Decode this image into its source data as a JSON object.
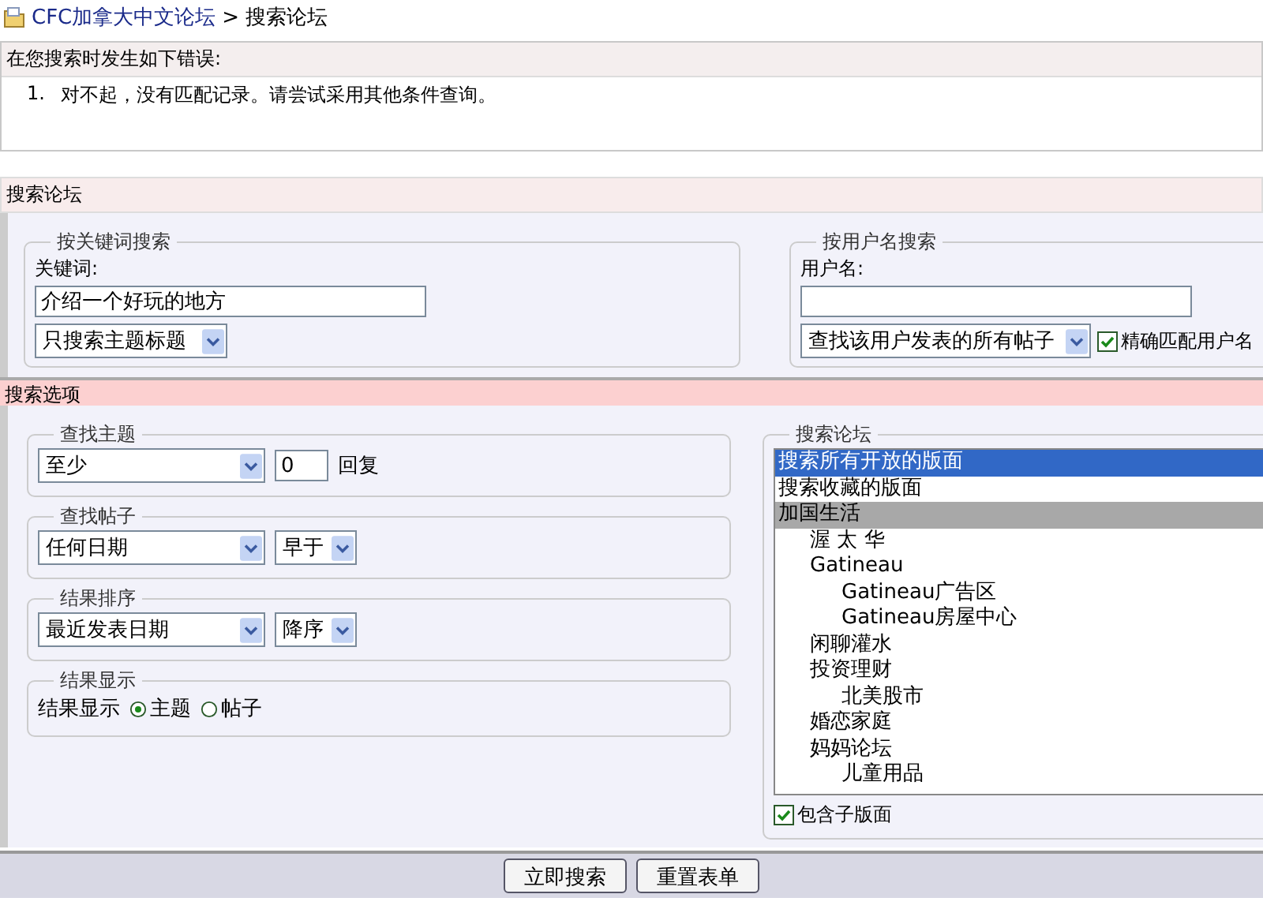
{
  "breadcrumb": {
    "site": "CFC加拿大中文论坛",
    "separator": ">",
    "current": "搜索论坛"
  },
  "error": {
    "title": "在您搜索时发生如下错误:",
    "messages": [
      {
        "number": "1.",
        "text": "对不起，没有匹配记录。请尝试采用其他条件查询。"
      }
    ]
  },
  "search_forum": {
    "title": "搜索论坛",
    "keyword": {
      "legend": "按关键词搜索",
      "label": "关键词:",
      "value": "介绍一个好玩的地方",
      "scope": "只搜索主题标题"
    },
    "user": {
      "legend": "按用户名搜索",
      "label": "用户名:",
      "scope": "查找该用户发表的所有帖子",
      "exact_match": {
        "label": "精确匹配用户名",
        "checked": true
      }
    }
  },
  "search_options": {
    "title": "搜索选项",
    "find_threads": {
      "legend": "查找主题",
      "condition": "至少",
      "count": "0",
      "unit": "回复"
    },
    "find_posts": {
      "legend": "查找帖子",
      "date": "任何日期",
      "direction": "早于"
    },
    "sort": {
      "legend": "结果排序",
      "field": "最近发表日期",
      "order": "降序"
    },
    "display": {
      "legend": "结果显示",
      "label": "结果显示",
      "options": [
        {
          "label": "主题",
          "selected": true
        },
        {
          "label": "帖子",
          "selected": false
        }
      ]
    },
    "forums": {
      "legend": "搜索论坛",
      "items": [
        {
          "label": "搜索所有开放的版面",
          "kind": "option",
          "selected": true
        },
        {
          "label": "搜索收藏的版面",
          "kind": "option",
          "selected": false
        },
        {
          "label": "加国生活",
          "kind": "category",
          "selected": false,
          "children": [
            {
              "label": "渥 太 华",
              "kind": "forum",
              "selected": false
            },
            {
              "label": "Gatineau",
              "kind": "forum",
              "selected": false,
              "children": [
                {
                  "label": "Gatineau广告区",
                  "kind": "forum",
                  "selected": false
                },
                {
                  "label": "Gatineau房屋中心",
                  "kind": "forum",
                  "selected": false
                }
              ]
            },
            {
              "label": "闲聊灌水",
              "kind": "forum",
              "selected": false
            },
            {
              "label": "投资理财",
              "kind": "forum",
              "selected": false,
              "children": [
                {
                  "label": "北美股市",
                  "kind": "forum",
                  "selected": false
                }
              ]
            },
            {
              "label": "婚恋家庭",
              "kind": "forum",
              "selected": false
            },
            {
              "label": "妈妈论坛",
              "kind": "forum",
              "selected": false,
              "children": [
                {
                  "label": "儿童用品",
                  "kind": "forum",
                  "selected": false
                }
              ]
            }
          ]
        }
      ],
      "include_subforums": {
        "label": "包含子版面",
        "checked": true
      }
    }
  },
  "buttons": [
    "立即搜索",
    "重置表单"
  ]
}
